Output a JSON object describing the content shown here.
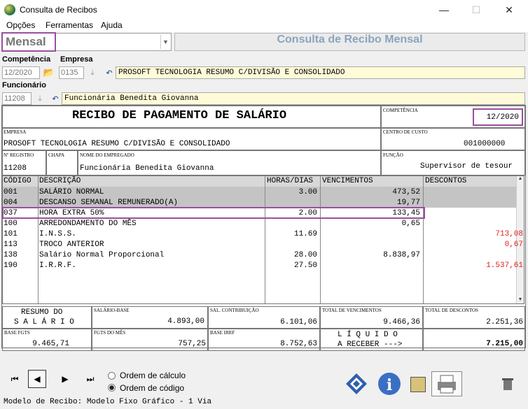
{
  "window": {
    "title": "Consulta de Recibos",
    "minimize": "—",
    "maximize": "☐",
    "close": "✕"
  },
  "menu": [
    "Opções",
    "Ferramentas",
    "Ajuda"
  ],
  "mode": {
    "value": "Mensal",
    "title": "Consulta de Recibo Mensal"
  },
  "filters": {
    "competencia_label": "Competência",
    "competencia_value": "12/2020",
    "empresa_label": "Empresa",
    "empresa_code": "0135",
    "empresa_name": "PROSOFT TECNOLOGIA RESUMO C/DIVISÃO E CONSOLIDADO",
    "funcionario_label": "Funcionário",
    "funcionario_code": "11208",
    "funcionario_name": "Funcionária Benedita Giovanna"
  },
  "receipt": {
    "heading": "RECIBO DE PAGAMENTO DE SALÁRIO",
    "competencia_label": "COMPETÊNCIA",
    "competencia": "12/2020",
    "empresa_label": "EMPRESA",
    "empresa": "PROSOFT TECNOLOGIA RESUMO C/DIVISÃO E CONSOLIDADO",
    "centro_label": "CENTRO DE CUSTO",
    "centro": "001000000",
    "registro_label": "Nº REGISTRO",
    "registro": "11208",
    "chapa_label": "CHAPA",
    "nome_label": "NOME DO EMPREGADO",
    "nome": "Funcionária Benedita Giovanna",
    "funcao_label": "FUNÇÃO",
    "funcao": "Supervisor de tesour",
    "headers": {
      "codigo": "CÓDIGO",
      "descricao": "DESCRIÇÃO",
      "horas": "HORAS/DIAS",
      "vencimentos": "VENCIMENTOS",
      "descontos": "DESCONTOS"
    },
    "rows": [
      {
        "codigo": "001",
        "descricao": "SALÁRIO NORMAL",
        "horas": "3.00",
        "vencimentos": "473,52",
        "descontos": ""
      },
      {
        "codigo": "004",
        "descricao": "DESCANSO SEMANAL REMUNERADO(A)",
        "horas": "",
        "vencimentos": "19,77",
        "descontos": ""
      },
      {
        "codigo": "037",
        "descricao": "HORA EXTRA 50%",
        "horas": "2.00",
        "vencimentos": "133,45",
        "descontos": ""
      },
      {
        "codigo": "100",
        "descricao": "ARREDONDAMENTO DO MÊS",
        "horas": "",
        "vencimentos": "0,65",
        "descontos": ""
      },
      {
        "codigo": "101",
        "descricao": "I.N.S.S.",
        "horas": "11.69",
        "vencimentos": "",
        "descontos": "713,08"
      },
      {
        "codigo": "113",
        "descricao": "TROCO ANTERIOR",
        "horas": "",
        "vencimentos": "",
        "descontos": "0,67"
      },
      {
        "codigo": "138",
        "descricao": "Salário Normal Proporcional",
        "horas": "28.00",
        "vencimentos": "8.838,97",
        "descontos": ""
      },
      {
        "codigo": "190",
        "descricao": "I.R.R.F.",
        "horas": "27.50",
        "vencimentos": "",
        "descontos": "1.537,61"
      }
    ],
    "resumo_line1": "RESUMO DO",
    "resumo_line2": "S A L Á R I O",
    "salario_base_label": "SALÁRIO-BASE",
    "salario_base": "4.893,00",
    "sal_contrib_label": "SAL. CONTRIBUIÇÃO",
    "sal_contrib": "6.101,06",
    "total_venc_label": "TOTAL DE VENCIMENTOS",
    "total_venc": "9.466,36",
    "total_desc_label": "TOTAL DE DESCONTOS",
    "total_desc": "2.251,36",
    "base_fgts_label": "BASE FGTS",
    "base_fgts": "9.465,71",
    "fgts_mes_label": "FGTS DO MÊS",
    "fgts_mes": "757,25",
    "base_irrf_label": "BASE IRRF",
    "base_irrf": "8.752,63",
    "liquido_line1": "L Í Q U I D O",
    "liquido_line2": "A RECEBER --->",
    "liquido": "7.215,00"
  },
  "bottom": {
    "ordem_calculo": "Ordem de cálculo",
    "ordem_codigo": "Ordem de código",
    "status": "Modelo de Recibo: Modelo Fixo Gráfico - 1 Via"
  },
  "colors": {
    "highlight": "#9b4ea0",
    "discount": "#e0201a",
    "yellow": "#fffbd8"
  }
}
